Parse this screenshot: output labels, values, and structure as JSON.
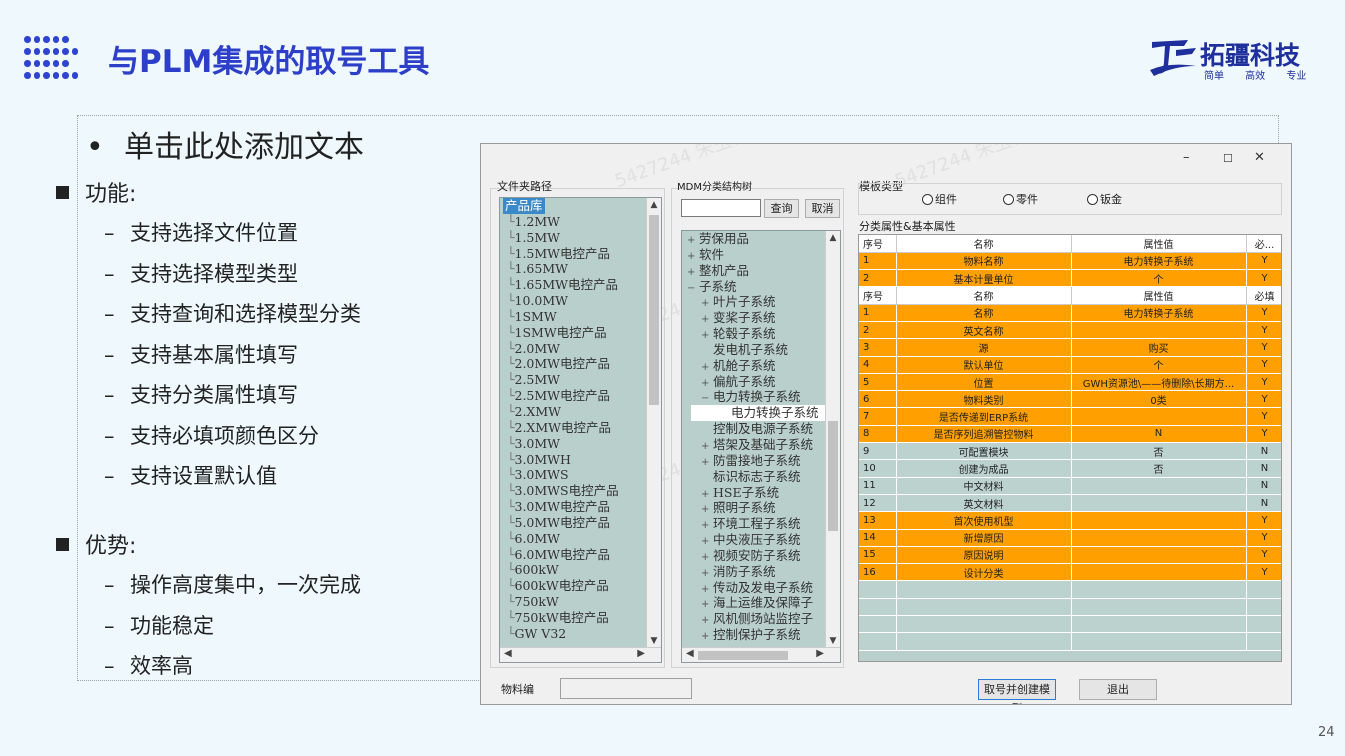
{
  "slide": {
    "title": "与PLM集成的取号工具",
    "page_number": "24",
    "logo": {
      "name": "拓疆科技",
      "slogan": "简单 高效 专业"
    },
    "placeholder": "单击此处添加文本",
    "bullet_char": "•",
    "sections": [
      {
        "heading": "功能:",
        "items": [
          "支持选择文件位置",
          "支持选择模型类型",
          "支持查询和选择模型分类",
          "支持基本属性填写",
          "支持分类属性填写",
          "支持必填项颜色区分",
          "支持设置默认值"
        ]
      },
      {
        "heading": "优势:",
        "items": [
          "操作高度集中，一次完成",
          "功能稳定",
          "效率高"
        ]
      }
    ],
    "dash": "–"
  },
  "dialog": {
    "window_controls": {
      "minimize": "–",
      "maximize": "☐",
      "close": "✕"
    },
    "folder_path_label": "文件夹路径",
    "folder_tree": [
      "产品库",
      "1.2MW",
      "1.5MW",
      "1.5MW电控产品",
      "1.65MW",
      "1.65MW电控产品",
      "10.0MW",
      "1SMW",
      "1SMW电控产品",
      "2.0MW",
      "2.0MW电控产品",
      "2.5MW",
      "2.5MW电控产品",
      "2.XMW",
      "2.XMW电控产品",
      "3.0MW",
      "3.0MWH",
      "3.0MWS",
      "3.0MWS电控产品",
      "3.0MW电控产品",
      "5.0MW电控产品",
      "6.0MW",
      "6.0MW电控产品",
      "600kW",
      "600kW电控产品",
      "750kW",
      "750kW电控产品",
      "GW V32"
    ],
    "mdm_label": "MDM分类结构树",
    "search_value": "",
    "query_button": "查询",
    "cancel_button": "取消",
    "class_tree": [
      {
        "indent": 0,
        "text": "劳保用品",
        "sym": "+"
      },
      {
        "indent": 0,
        "text": "软件",
        "sym": "+"
      },
      {
        "indent": 0,
        "text": "整机产品",
        "sym": "+"
      },
      {
        "indent": 0,
        "text": "子系统",
        "sym": "−"
      },
      {
        "indent": 1,
        "text": "叶片子系统",
        "sym": "+"
      },
      {
        "indent": 1,
        "text": "变桨子系统",
        "sym": "+"
      },
      {
        "indent": 1,
        "text": "轮毂子系统",
        "sym": "+"
      },
      {
        "indent": 1,
        "text": "发电机子系统",
        "sym": ""
      },
      {
        "indent": 1,
        "text": "机舱子系统",
        "sym": "+"
      },
      {
        "indent": 1,
        "text": "偏航子系统",
        "sym": "+"
      },
      {
        "indent": 1,
        "text": "电力转换子系统",
        "sym": "−"
      },
      {
        "indent": 2,
        "text": "电力转换子系统",
        "sym": "",
        "selected": true
      },
      {
        "indent": 1,
        "text": "控制及电源子系统",
        "sym": ""
      },
      {
        "indent": 1,
        "text": "塔架及基础子系统",
        "sym": "+"
      },
      {
        "indent": 1,
        "text": "防雷接地子系统",
        "sym": "+"
      },
      {
        "indent": 1,
        "text": "标识标志子系统",
        "sym": ""
      },
      {
        "indent": 1,
        "text": "HSE子系统",
        "sym": "+"
      },
      {
        "indent": 1,
        "text": "照明子系统",
        "sym": "+"
      },
      {
        "indent": 1,
        "text": "环境工程子系统",
        "sym": "+"
      },
      {
        "indent": 1,
        "text": "中央液压子系统",
        "sym": "+"
      },
      {
        "indent": 1,
        "text": "视频安防子系统",
        "sym": "+"
      },
      {
        "indent": 1,
        "text": "消防子系统",
        "sym": "+"
      },
      {
        "indent": 1,
        "text": "传动及发电子系统",
        "sym": "+"
      },
      {
        "indent": 1,
        "text": "海上运维及保障子",
        "sym": "+"
      },
      {
        "indent": 1,
        "text": "风机侧场站监控子",
        "sym": "+"
      },
      {
        "indent": 1,
        "text": "控制保护子系统",
        "sym": "+"
      }
    ],
    "template_type_label": "模板类型",
    "template_options": [
      "组件",
      "零件",
      "钣金"
    ],
    "attr_label": "分类属性&基本属性",
    "table_header_1": [
      "序号",
      "名称",
      "属性值",
      "必..."
    ],
    "basic_rows": [
      [
        "1",
        "物料名称",
        "电力转换子系统",
        "Y"
      ],
      [
        "2",
        "基本计量单位",
        "个",
        "Y"
      ]
    ],
    "table_header_2": [
      "序号",
      "名称",
      "属性值",
      "必填"
    ],
    "class_rows": [
      [
        "1",
        "名称",
        "电力转换子系统",
        "Y"
      ],
      [
        "2",
        "英文名称",
        "",
        "Y"
      ],
      [
        "3",
        "源",
        "购买",
        "Y"
      ],
      [
        "4",
        "默认单位",
        "个",
        "Y"
      ],
      [
        "5",
        "位置",
        "GWH资源池\\——待删除\\长期方...",
        "Y"
      ],
      [
        "6",
        "物料类别",
        "0类",
        "Y"
      ],
      [
        "7",
        "是否传递到ERP系统",
        "",
        "Y"
      ],
      [
        "8",
        "是否序列追溯管控物料",
        "N",
        "Y"
      ],
      [
        "9",
        "可配置模块",
        "否",
        "N"
      ],
      [
        "10",
        "创建为成品",
        "否",
        "N"
      ],
      [
        "11",
        "中文材料",
        "",
        "N"
      ],
      [
        "12",
        "英文材料",
        "",
        "N"
      ],
      [
        "13",
        "首次使用机型",
        "",
        "Y"
      ],
      [
        "14",
        "新增原因",
        "",
        "Y"
      ],
      [
        "15",
        "原因说明",
        "",
        "Y"
      ],
      [
        "16",
        "设计分类",
        "",
        "Y"
      ]
    ],
    "material_code_label": "物料编",
    "material_code_value": "",
    "create_button": "取号并创建模型",
    "exit_button": "退出",
    "watermark": "5427244 宋玉林"
  }
}
